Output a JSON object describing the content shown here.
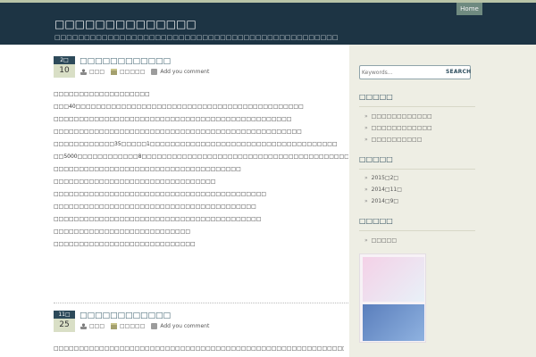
{
  "header": {
    "home_label": "Home",
    "site_title": "□□□□□□□□□□□□□□",
    "site_description": "□□□□□□□□□□□□□□□□□□□□□□□□□□□□□□□□□□□□□□□□□□□□□□□□"
  },
  "posts": [
    {
      "month": "2□",
      "day": "10",
      "title": "□□□□□□□□□□□□",
      "author": "□□□",
      "category": "□□□□□",
      "comment": "Add you comment",
      "paragraphs": [
        "□□□□□□□□□□□□□□□□□□□",
        "□□□40□□□□□□□□□□□□□□□□□□□□□□□□□□□□□□□□□□□□□□□□□□□□□",
        "□□□□□□□□□□□□□□□□□□□□□□□□□□□□□□□□□□□□□□□□□□□□□□□",
        "□□□□□□□□□□□□□□□□□□□□□□□□□□□□□□□□□□□□□□□□□□□□□□□□□",
        "□□□□□□□□□□□□35□□□□□1□□□□□□□□□□□□□□□□□□□□□□□□□□□□□□□□□□□□□",
        "□□5000□□□□□□□□□□□□8□□□□□□□□□□□□□□□□□□□□□□□□□□□□□□□□□□□□□□□□□□□□□□□□□□□□□□□□□□",
        "□□□□□□□□□□□□□□□□□□□□□□□□□□□□□□□□□□□□□",
        "□□□□□□□□□□□□□□□□□□□□□□□□□□□□□□□□",
        "□□□□□□□□□□□□□□□□□□□□□□□□□□□□□□□□□□□□□□□□□□",
        "□□□□□□□□□□□□□□□□□□□□□□□□□□□□□□□□□□□□□□□□",
        "□□□□□□□□□□□□□□□□□□□□□□□□□□□□□□□□□□□□□□□□□",
        "□□□□□□□□□□□□□□□□□□□□□□□□□□□",
        "□□□□□□□□□□□□□□□□□□□□□□□□□□□□"
      ]
    },
    {
      "month": "11□",
      "day": "25",
      "title": "□□□□□□□□□□□□",
      "author": "□□□",
      "category": "□□□□□",
      "comment": "Add you comment",
      "paragraphs": [
        "□□□□□□□□□□□□□□□□□□□□□□□□□□□□□□□□□□□□□□□□□□□□□□□□□□□□□□□□□□□□□□□□□□□□□□□□□□□□□□□□□□□□□□□□□□□□□□□□□□□□□□□□□□□□□□□□□□□□□□□□□□□□□□□□□□□□□□□□□□"
      ]
    }
  ],
  "sidebar": {
    "search_placeholder": "Keywords...",
    "search_button": "SEARCH",
    "recent_title": "□□□□□",
    "recent_items": [
      "□□□□□□□□□□□□",
      "□□□□□□□□□□□□",
      "□□□□□□□□□□"
    ],
    "archive_title": "□□□□□",
    "archive_items": [
      "2015□2□",
      "2014□11□",
      "2014□9□"
    ],
    "category_title": "□□□□□",
    "category_items": [
      "□□□□□"
    ]
  }
}
